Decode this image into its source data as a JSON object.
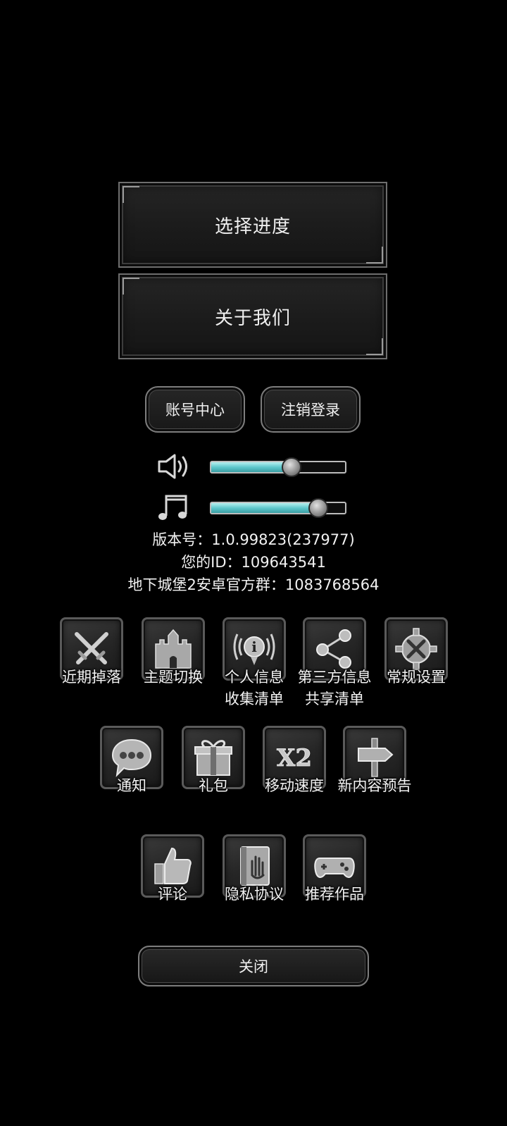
{
  "menu": {
    "select_progress": "选择进度",
    "about_us": "关于我们"
  },
  "account": {
    "account_center": "账号中心",
    "logout": "注销登录"
  },
  "audio": {
    "sound_level": 0.59,
    "music_level": 0.79,
    "sound_icon": "speaker-icon",
    "music_icon": "music-note-icon",
    "fill_color": "#5fc8cc"
  },
  "info": {
    "version": "版本号：1.0.99823(237977)",
    "user_id": "您的ID：109643541",
    "group": "地下城堡2安卓官方群：1083768564"
  },
  "grid_row1": [
    {
      "icon": "crossed-swords-icon",
      "label": "近期掉落"
    },
    {
      "icon": "castle-icon",
      "label": "主题切换"
    },
    {
      "icon": "info-broadcast-icon",
      "label": "个人信息\n收集清单"
    },
    {
      "icon": "share-icon",
      "label": "第三方信息\n共享清单"
    },
    {
      "icon": "gear-tools-icon",
      "label": "常规设置"
    }
  ],
  "grid_row2": [
    {
      "icon": "chat-bubble-icon",
      "label": "通知"
    },
    {
      "icon": "gift-icon",
      "label": "礼包"
    },
    {
      "icon": "x2-speed-icon",
      "label": "移动速度",
      "icon_text": "X2"
    },
    {
      "icon": "signpost-icon",
      "label": "新内容预告"
    }
  ],
  "grid_row3": [
    {
      "icon": "thumbs-up-icon",
      "label": "评论"
    },
    {
      "icon": "privacy-book-icon",
      "label": "隐私协议"
    },
    {
      "icon": "gamepad-icon",
      "label": "推荐作品"
    }
  ],
  "close_label": "关闭"
}
